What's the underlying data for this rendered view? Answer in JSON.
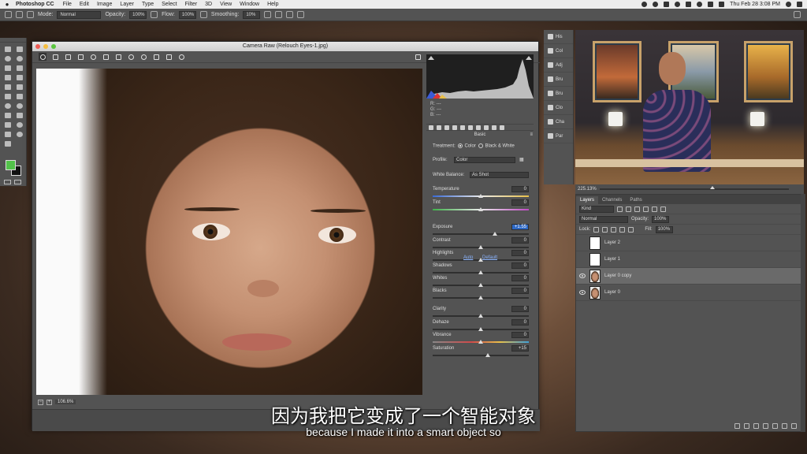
{
  "menubar": {
    "app_name": "Photoshop CC",
    "menus": [
      "File",
      "Edit",
      "Image",
      "Layer",
      "Type",
      "Select",
      "Filter",
      "3D",
      "View",
      "Window",
      "Help"
    ],
    "clock": "Thu Feb 28  3:08 PM"
  },
  "options_bar": {
    "mode_label": "Mode:",
    "mode_value": "Normal",
    "opacity_label": "Opacity:",
    "opacity_value": "100%",
    "flow_label": "Flow:",
    "flow_value": "100%",
    "smoothing_label": "Smoothing:",
    "smoothing_value": "10%"
  },
  "camera_raw": {
    "title": "Camera Raw (Relouch Eyes-1.jpg)",
    "zoom": "106.6%",
    "rgb": {
      "r": "R:  ---",
      "g": "G:  ---",
      "b": "B:  ---"
    },
    "panel_title": "Basic",
    "treatment_label": "Treatment:",
    "treatment_color": "Color",
    "treatment_bw": "Black & White",
    "profile_label": "Profile:",
    "profile_value": "Color",
    "wb_label": "White Balance:",
    "wb_value": "As Shot",
    "auto": "Auto",
    "default": "Default",
    "sliders": [
      {
        "label": "Temperature",
        "value": "0",
        "pos": 0.5
      },
      {
        "label": "Tint",
        "value": "0",
        "pos": 0.5
      },
      {
        "label": "Exposure",
        "value": "+1.55",
        "pos": 0.65
      },
      {
        "label": "Contrast",
        "value": "0",
        "pos": 0.5
      },
      {
        "label": "Highlights",
        "value": "0",
        "pos": 0.5
      },
      {
        "label": "Shadows",
        "value": "0",
        "pos": 0.5
      },
      {
        "label": "Whites",
        "value": "0",
        "pos": 0.5
      },
      {
        "label": "Blacks",
        "value": "0",
        "pos": 0.5
      },
      {
        "label": "Clarity",
        "value": "0",
        "pos": 0.5
      },
      {
        "label": "Dehaze",
        "value": "0",
        "pos": 0.5
      },
      {
        "label": "Vibrance",
        "value": "0",
        "pos": 0.5
      },
      {
        "label": "Saturation",
        "value": "+15",
        "pos": 0.57
      }
    ]
  },
  "collapsed_panels": [
    "His",
    "Col",
    "Adj",
    "Bru",
    "Bru",
    "Clo",
    "Cha",
    "Par"
  ],
  "video": {
    "zoom": "225.13%"
  },
  "layers_panel": {
    "tabs": [
      "Layers",
      "Channels",
      "Paths"
    ],
    "kind_value": "Kind",
    "blend_value": "Normal",
    "opacity_label": "Opacity:",
    "opacity_value": "100%",
    "lock_label": "Lock:",
    "fill_label": "Fill:",
    "fill_value": "100%",
    "layers": [
      {
        "name": "Layer 2",
        "visible": false,
        "photo": false,
        "selected": false
      },
      {
        "name": "Layer 1",
        "visible": false,
        "photo": false,
        "selected": false
      },
      {
        "name": "Layer 0 copy",
        "visible": true,
        "photo": true,
        "selected": true
      },
      {
        "name": "Layer 0",
        "visible": true,
        "photo": true,
        "selected": false
      }
    ]
  },
  "subtitles": {
    "chinese": "因为我把它变成了一个智能对象",
    "english": "because I made it into a smart object so"
  }
}
